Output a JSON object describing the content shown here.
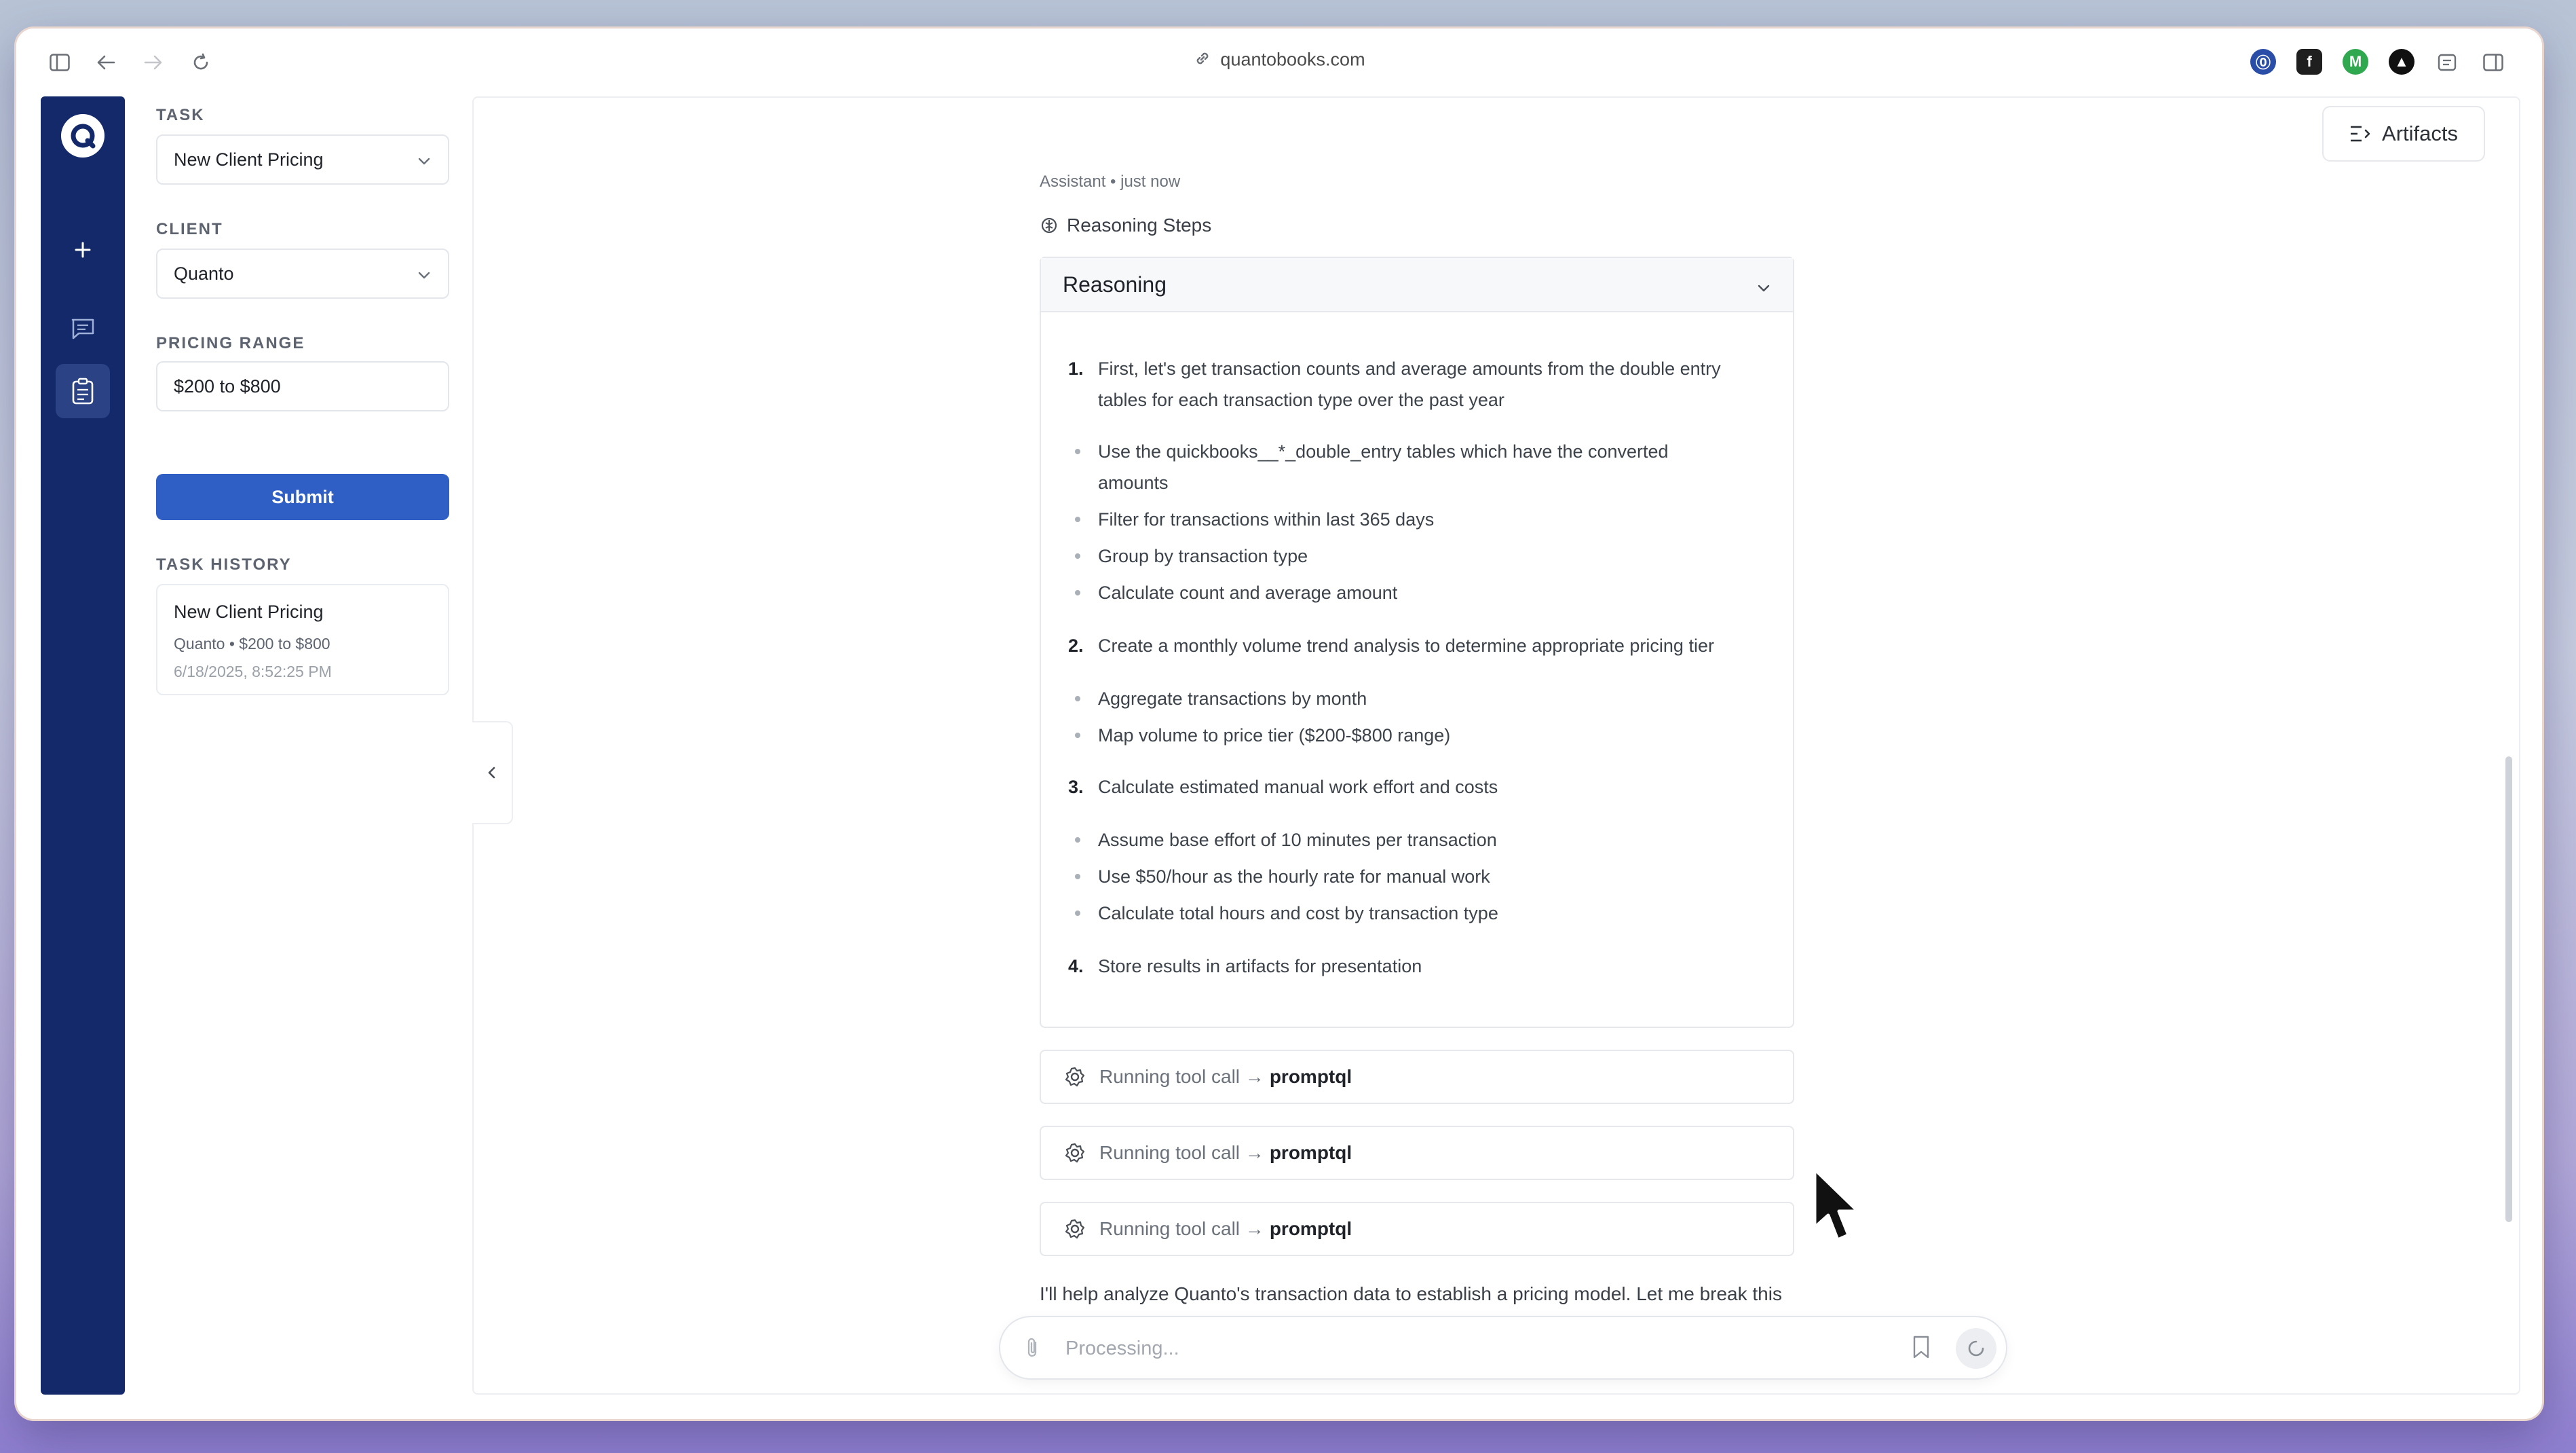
{
  "browser": {
    "url": "quantobooks.com"
  },
  "panel": {
    "task_label": "TASK",
    "task_value": "New Client Pricing",
    "client_label": "CLIENT",
    "client_value": "Quanto",
    "range_label": "PRICING RANGE",
    "range_value": "$200 to $800",
    "submit_label": "Submit",
    "history_label": "TASK HISTORY",
    "history": [
      {
        "title": "New Client Pricing",
        "meta": "Quanto • $200 to $800",
        "date": "6/18/2025, 8:52:25 PM"
      }
    ]
  },
  "main": {
    "artifacts_label": "Artifacts",
    "meta": "Assistant • just now",
    "steps_label": "Reasoning Steps",
    "reasoning_title": "Reasoning",
    "steps": [
      {
        "num": "1.",
        "line1": "First, let's get transaction counts and average amounts from the double entry",
        "line2": "tables for each transaction type over the past year",
        "bullets": [
          "Use the quickbooks__*_double_entry tables which have the converted",
          "amounts",
          "Filter for transactions within last 365 days",
          "Group by transaction type",
          "Calculate count and average amount"
        ]
      },
      {
        "num": "2.",
        "line1": "Create a monthly volume trend analysis to determine appropriate pricing tier",
        "bullets": [
          "Aggregate transactions by month",
          "Map volume to price tier ($200-$800 range)"
        ]
      },
      {
        "num": "3.",
        "line1": "Calculate estimated manual work effort and costs",
        "bullets": [
          "Assume base effort of 10 minutes per transaction",
          "Use $50/hour as the hourly rate for manual work",
          "Calculate total hours and cost by transaction type"
        ]
      },
      {
        "num": "4.",
        "line1": "Store results in artifacts for presentation"
      }
    ],
    "tool_calls": [
      {
        "prefix": "Running tool call →",
        "name": "promptql"
      },
      {
        "prefix": "Running tool call →",
        "name": "promptql"
      },
      {
        "prefix": "Running tool call →",
        "name": "promptql"
      }
    ],
    "tail_text": "I'll help analyze Quanto's transaction data to establish a pricing model. Let me break this",
    "composer_placeholder": "Processing..."
  },
  "colors": {
    "rail": "#13296a",
    "accent": "#2f5fc4"
  }
}
